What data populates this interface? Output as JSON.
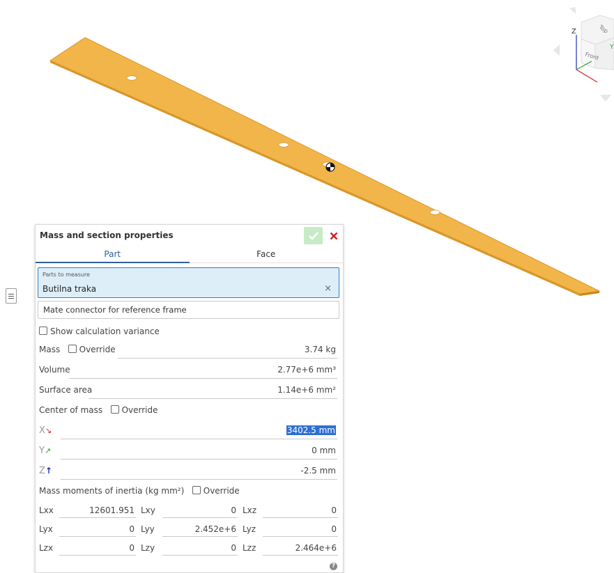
{
  "viewcube": {
    "z_label": "Z",
    "top_label": "Top",
    "front_label": "Front",
    "y_label": "Y"
  },
  "panel": {
    "title": "Mass and section properties",
    "tabs": [
      {
        "label": "Part",
        "active": true
      },
      {
        "label": "Face",
        "active": false
      }
    ],
    "parts_field": {
      "label": "Parts to measure",
      "value": "Butilna traka",
      "clear": "×"
    },
    "mate_connector_placeholder": "Mate connector for reference frame",
    "show_variance_label": "Show calculation variance",
    "mass": {
      "label": "Mass",
      "override_label": "Override",
      "value": "3.74 kg"
    },
    "volume": {
      "label": "Volume",
      "value": "2.77e+6 mm³"
    },
    "surface_area": {
      "label": "Surface area",
      "value": "1.14e+6 mm²"
    },
    "center_of_mass": {
      "label": "Center of mass",
      "override_label": "Override",
      "x": {
        "axis": "X",
        "arrow": "↘",
        "value": "3402.5 mm"
      },
      "y": {
        "axis": "Y",
        "arrow": "↗",
        "value": "0 mm"
      },
      "z": {
        "axis": "Z",
        "arrow": "↑",
        "value": "-2.5 mm"
      }
    },
    "inertia": {
      "label": "Mass moments of inertia (kg mm²)",
      "override_label": "Override",
      "rows": [
        [
          {
            "label": "Lxx",
            "value": "12601.951"
          },
          {
            "label": "Lxy",
            "value": "0"
          },
          {
            "label": "Lxz",
            "value": "0"
          }
        ],
        [
          {
            "label": "Lyx",
            "value": "0"
          },
          {
            "label": "Lyy",
            "value": "2.452e+6"
          },
          {
            "label": "Lyz",
            "value": "0"
          }
        ],
        [
          {
            "label": "Lzx",
            "value": "0"
          },
          {
            "label": "Lzy",
            "value": "0"
          },
          {
            "label": "Lzz",
            "value": "2.464e+6"
          }
        ]
      ]
    },
    "help": "?"
  },
  "colors": {
    "part_fill": "#f2b54a",
    "accent": "#2e5f9c",
    "ok": "#4cbb4c",
    "close": "#d32020"
  }
}
